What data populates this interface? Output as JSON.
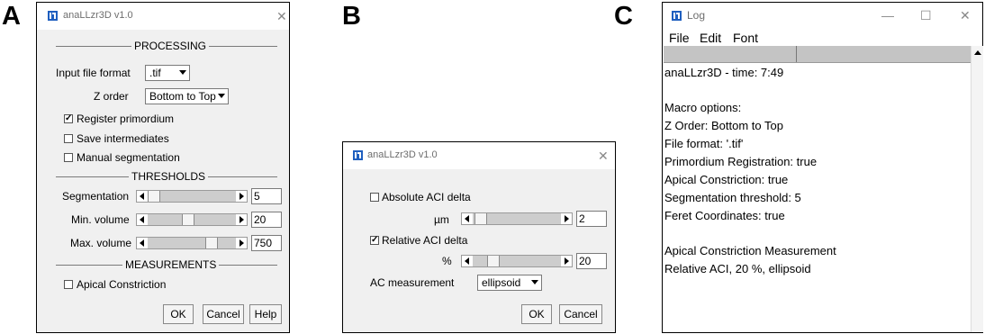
{
  "panels": {
    "a": "A",
    "b": "B",
    "c": "C"
  },
  "dialog_a": {
    "title": "anaLLzr3D v1.0",
    "icon": "imagej-icon",
    "close_glyph": "✕",
    "section_processing": "PROCESSING",
    "input_file_format_label": "Input file format",
    "input_file_format_value": ".tif",
    "z_order_label": "Z order",
    "z_order_value": "Bottom to Top",
    "register_primordium": {
      "label": "Register primordium",
      "checked": true
    },
    "save_intermediates": {
      "label": "Save intermediates",
      "checked": false
    },
    "manual_segmentation": {
      "label": "Manual segmentation",
      "checked": false
    },
    "section_thresholds": "THRESHOLDS",
    "segmentation": {
      "label": "Segmentation",
      "value": "5"
    },
    "min_volume": {
      "label": "Min. volume",
      "value": "20"
    },
    "max_volume": {
      "label": "Max. volume",
      "value": "750"
    },
    "section_measurements": "MEASUREMENTS",
    "apical_constriction": {
      "label": "Apical Constriction",
      "checked": false
    },
    "ok": "OK",
    "cancel": "Cancel",
    "help": "Help"
  },
  "dialog_b": {
    "title": "anaLLzr3D v1.0",
    "icon": "imagej-icon",
    "close_glyph": "✕",
    "absolute_aci": {
      "label": "Absolute ACI delta",
      "checked": false
    },
    "um_label": "µm",
    "um_value": "2",
    "relative_aci": {
      "label": "Relative ACI delta",
      "checked": true
    },
    "pct_label": "%",
    "pct_value": "20",
    "ac_measurement_label": "AC measurement",
    "ac_measurement_value": "ellipsoid",
    "ok": "OK",
    "cancel": "Cancel"
  },
  "log_window": {
    "title": "Log",
    "icon": "imagej-icon",
    "minimize_glyph": "—",
    "maximize_glyph": "☐",
    "close_glyph": "✕",
    "menu": [
      "File",
      "Edit",
      "Font"
    ],
    "lines": [
      "anaLLzr3D - time: 7:49",
      "",
      "Macro options:",
      "  Z Order: Bottom to Top",
      "  File format: '.tif'",
      "  Primordium Registration: true",
      "  Apical Constriction: true",
      "     Segmentation threshold: 5",
      "  Feret Coordinates: true",
      "",
      "Apical Constriction Measurement",
      "    Relative ACI, 20 %, ellipsoid"
    ]
  }
}
